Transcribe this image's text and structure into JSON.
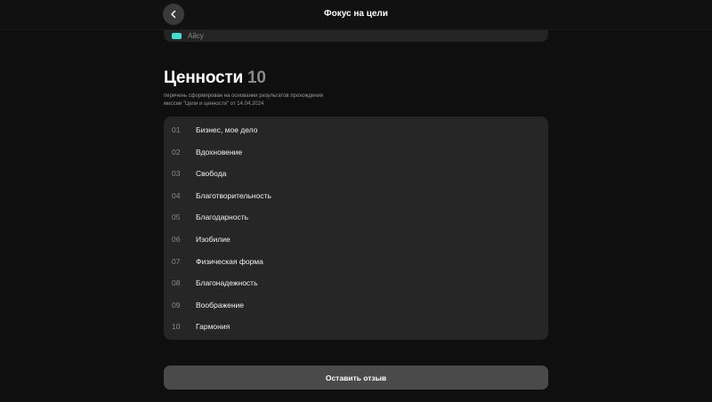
{
  "header": {
    "title": "Фокус на цели",
    "back_icon": "chevron-left-icon"
  },
  "previous_card": {
    "label": "Айсу",
    "chip_color": "#3fe0d0"
  },
  "values": {
    "title": "Ценности",
    "count": "10",
    "note": "перечень сформирован на основании результатов прохождения миссии \"Цели и ценности\" от 14.04.2024",
    "items": [
      {
        "num": "01",
        "label": "Бизнес, мое дело"
      },
      {
        "num": "02",
        "label": "Вдохновение"
      },
      {
        "num": "03",
        "label": "Свобода"
      },
      {
        "num": "04",
        "label": "Благотворительность"
      },
      {
        "num": "05",
        "label": "Благодарность"
      },
      {
        "num": "06",
        "label": "Изобилие"
      },
      {
        "num": "07",
        "label": "Физическая форма"
      },
      {
        "num": "08",
        "label": "Благонадежность"
      },
      {
        "num": "09",
        "label": "Воображение"
      },
      {
        "num": "10",
        "label": "Гармония"
      }
    ]
  },
  "footer": {
    "feedback_label": "Оставить отзыв"
  }
}
